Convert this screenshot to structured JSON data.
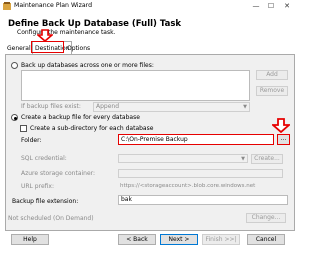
{
  "window": {
    "title": "Maintenance Plan Wizard",
    "minimize": "—",
    "maximize": "☐",
    "close": "✕"
  },
  "header": {
    "title": "Define Back Up Database (Full) Task",
    "subtitle": "Configure the maintenance task."
  },
  "tabs": [
    {
      "label": "General"
    },
    {
      "label": "Destination"
    },
    {
      "label": "Options"
    }
  ],
  "destination": {
    "across_files_label": "Back up databases across one or more files:",
    "add_label": "Add",
    "remove_label": "Remove",
    "if_exists_label": "If backup files exist:",
    "if_exists_value": "Append",
    "create_file_label": "Create a backup file for every database",
    "subdir_label": "Create a sub-directory for each database",
    "folder_label": "Folder:",
    "folder_value": "C:\\On-Premise Backup",
    "browse_label": "...",
    "sql_credential_label": "SQL credential:",
    "create_label": "Create...",
    "azure_container_label": "Azure storage container:",
    "url_prefix_label": "URL prefix:",
    "url_prefix_value": "https://<storageaccount>.blob.core.windows.net",
    "extension_label": "Backup file extension:",
    "extension_value": "bak"
  },
  "schedule": {
    "text": "Not scheduled (On Demand)",
    "change_label": "Change..."
  },
  "footer": {
    "help": "Help",
    "back": "< Back",
    "next": "Next >",
    "finish": "Finish >>|",
    "cancel": "Cancel"
  },
  "colors": {
    "annotation": "#e60000"
  }
}
